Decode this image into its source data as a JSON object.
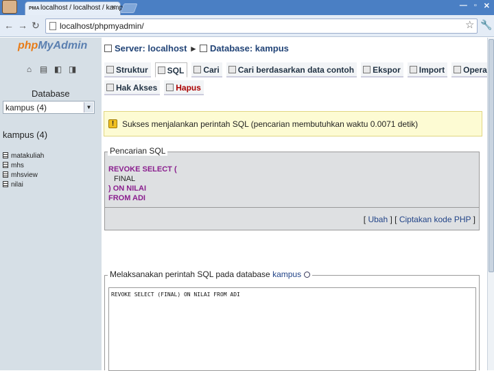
{
  "browser": {
    "tab_title": "localhost / localhost / kampus",
    "favicon_text": "PMA",
    "url": "localhost/phpmyadmin/",
    "nav": {
      "back": "←",
      "forward": "→",
      "reload": "↻"
    },
    "close_tab": "×",
    "window_buttons": [
      "—",
      "▫",
      "✕"
    ],
    "star": "☆",
    "wrench": "🔧"
  },
  "left_panel": {
    "logo_php": "php",
    "logo_myadmin": "MyAdmin",
    "icons": [
      "home-icon",
      "sql-icon",
      "query-icon",
      "docs-icon"
    ],
    "icon_glyphs": [
      "⌂",
      "▤",
      "◧",
      "◨"
    ],
    "database_label": "Database",
    "select_value": "kampus (4)",
    "db_name": "kampus (4)",
    "tables": [
      "matakuliah",
      "mhs",
      "mhsview",
      "nilai"
    ]
  },
  "breadcrumb": {
    "server": "Server: localhost",
    "database": "Database: kampus",
    "sep": "▸"
  },
  "tabs": [
    {
      "label": "Struktur",
      "active": false
    },
    {
      "label": "SQL",
      "active": true
    },
    {
      "label": "Cari",
      "active": false
    },
    {
      "label": "Cari berdasarkan data contoh",
      "active": false
    },
    {
      "label": "Ekspor",
      "active": false
    },
    {
      "label": "Import",
      "active": false
    },
    {
      "label": "Operasi",
      "active": false
    }
  ],
  "tabs_row2": [
    {
      "label": "Hak Akses"
    },
    {
      "label": "Hapus"
    }
  ],
  "success": {
    "icon": "!",
    "message": "Sukses menjalankan perintah SQL (pencarian membutuhkan waktu 0.0071 detik)"
  },
  "sql_query": {
    "legend": "Pencarian SQL",
    "line1": "REVOKE SELECT (",
    "line2": "FINAL",
    "line3": ") ON NILAI",
    "line4": "FROM ADI"
  },
  "links": {
    "open": "[ ",
    "edit": "Ubah",
    "mid": " ] [ ",
    "php": "Ciptakan kode PHP",
    "close": " ]"
  },
  "run_sql": {
    "legend": "Melaksanakan perintah SQL pada database",
    "db_link": "kampus",
    "textarea_value": "REVOKE SELECT (FINAL) ON NILAI FROM ADI"
  }
}
